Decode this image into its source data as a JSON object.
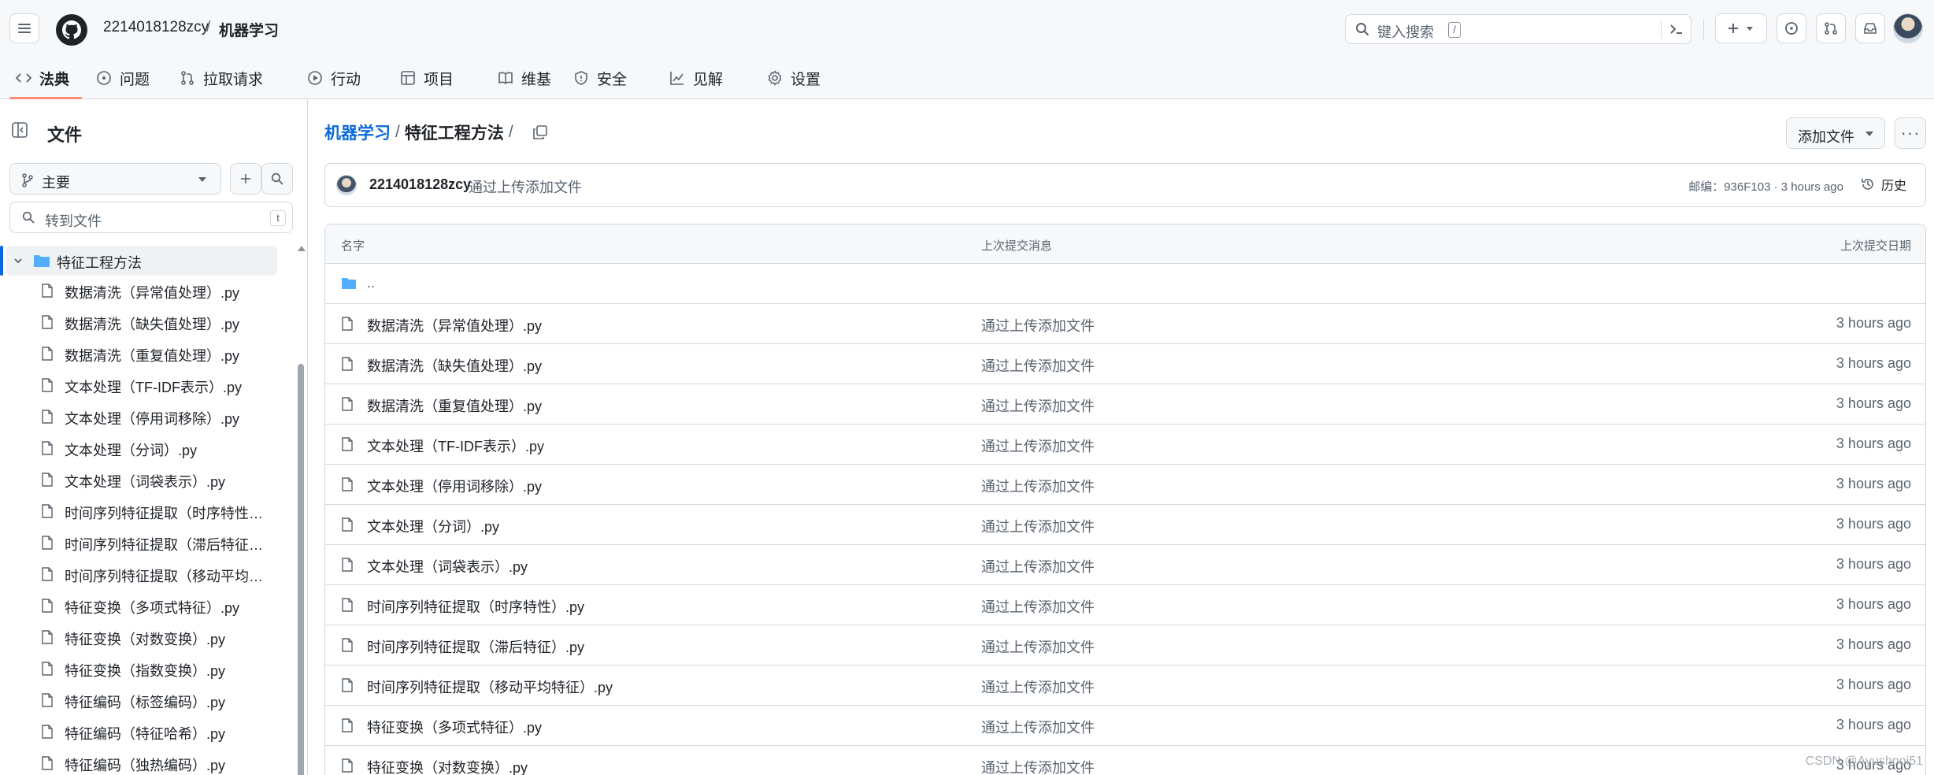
{
  "header": {
    "owner": "2214018128zcy",
    "separator": "/",
    "repo": "机器学习",
    "search_placeholder": "键入搜索",
    "search_shortcut": "/"
  },
  "repo_nav": [
    {
      "label": "法典",
      "icon": "code-icon",
      "active": true
    },
    {
      "label": "问题",
      "icon": "issue-icon"
    },
    {
      "label": "拉取请求",
      "icon": "pull-request-icon"
    },
    {
      "label": "行动",
      "icon": "play-icon"
    },
    {
      "label": "项目",
      "icon": "table-icon"
    },
    {
      "label": "维基",
      "icon": "book-icon"
    },
    {
      "label": "安全",
      "icon": "shield-icon"
    },
    {
      "label": "见解",
      "icon": "graph-icon"
    },
    {
      "label": "设置",
      "icon": "gear-icon"
    }
  ],
  "sidebar": {
    "title": "文件",
    "branch": "主要",
    "goto_placeholder": "转到文件",
    "goto_shortcut": "t",
    "folder": "特征工程方法",
    "files": [
      "数据清洗（异常值处理）.py",
      "数据清洗（缺失值处理）.py",
      "数据清洗（重复值处理）.py",
      "文本处理（TF-IDF表示）.py",
      "文本处理（停用词移除）.py",
      "文本处理（分词）.py",
      "文本处理（词袋表示）.py",
      "时间序列特征提取（时序特性）.py",
      "时间序列特征提取（滞后特征）.py",
      "时间序列特征提取（移动平均特征）.py",
      "特征变换（多项式特征）.py",
      "特征变换（对数变换）.py",
      "特征变换（指数变换）.py",
      "特征编码（标签编码）.py",
      "特征编码（特征哈希）.py",
      "特征编码（独热编码）.py"
    ]
  },
  "main": {
    "path_root": "机器学习",
    "path_sep": "/",
    "path_current": "特征工程方法",
    "path_trailing": "/",
    "add_file_label": "添加文件",
    "more_label": "···",
    "commit": {
      "author": "2214018128zcy",
      "message": "通过上传添加文件",
      "meta": "邮编：936F103 · 3 hours ago",
      "history_label": "历史"
    },
    "table": {
      "col_name": "名字",
      "col_message": "上次提交消息",
      "col_date": "上次提交日期",
      "parent": "..",
      "rows": [
        {
          "name": "数据清洗（异常值处理）.py",
          "message": "通过上传添加文件",
          "date": "3 hours ago"
        },
        {
          "name": "数据清洗（缺失值处理）.py",
          "message": "通过上传添加文件",
          "date": "3 hours ago"
        },
        {
          "name": "数据清洗（重复值处理）.py",
          "message": "通过上传添加文件",
          "date": "3 hours ago"
        },
        {
          "name": "文本处理（TF-IDF表示）.py",
          "message": "通过上传添加文件",
          "date": "3 hours ago"
        },
        {
          "name": "文本处理（停用词移除）.py",
          "message": "通过上传添加文件",
          "date": "3 hours ago"
        },
        {
          "name": "文本处理（分词）.py",
          "message": "通过上传添加文件",
          "date": "3 hours ago"
        },
        {
          "name": "文本处理（词袋表示）.py",
          "message": "通过上传添加文件",
          "date": "3 hours ago"
        },
        {
          "name": "时间序列特征提取（时序特性）.py",
          "message": "通过上传添加文件",
          "date": "3 hours ago"
        },
        {
          "name": "时间序列特征提取（滞后特征）.py",
          "message": "通过上传添加文件",
          "date": "3 hours ago"
        },
        {
          "name": "时间序列特征提取（移动平均特征）.py",
          "message": "通过上传添加文件",
          "date": "3 hours ago"
        },
        {
          "name": "特征变换（多项式特征）.py",
          "message": "通过上传添加文件",
          "date": "3 hours ago"
        },
        {
          "name": "特征变换（对数变换）.py",
          "message": "通过上传添加文件",
          "date": "3 hours ago"
        }
      ]
    }
  },
  "watermark": "CSDN @Ayushnoi51",
  "colors": {
    "accent": "#0969da",
    "nav_underline": "#fd8c73",
    "folder": "#54aeff"
  }
}
